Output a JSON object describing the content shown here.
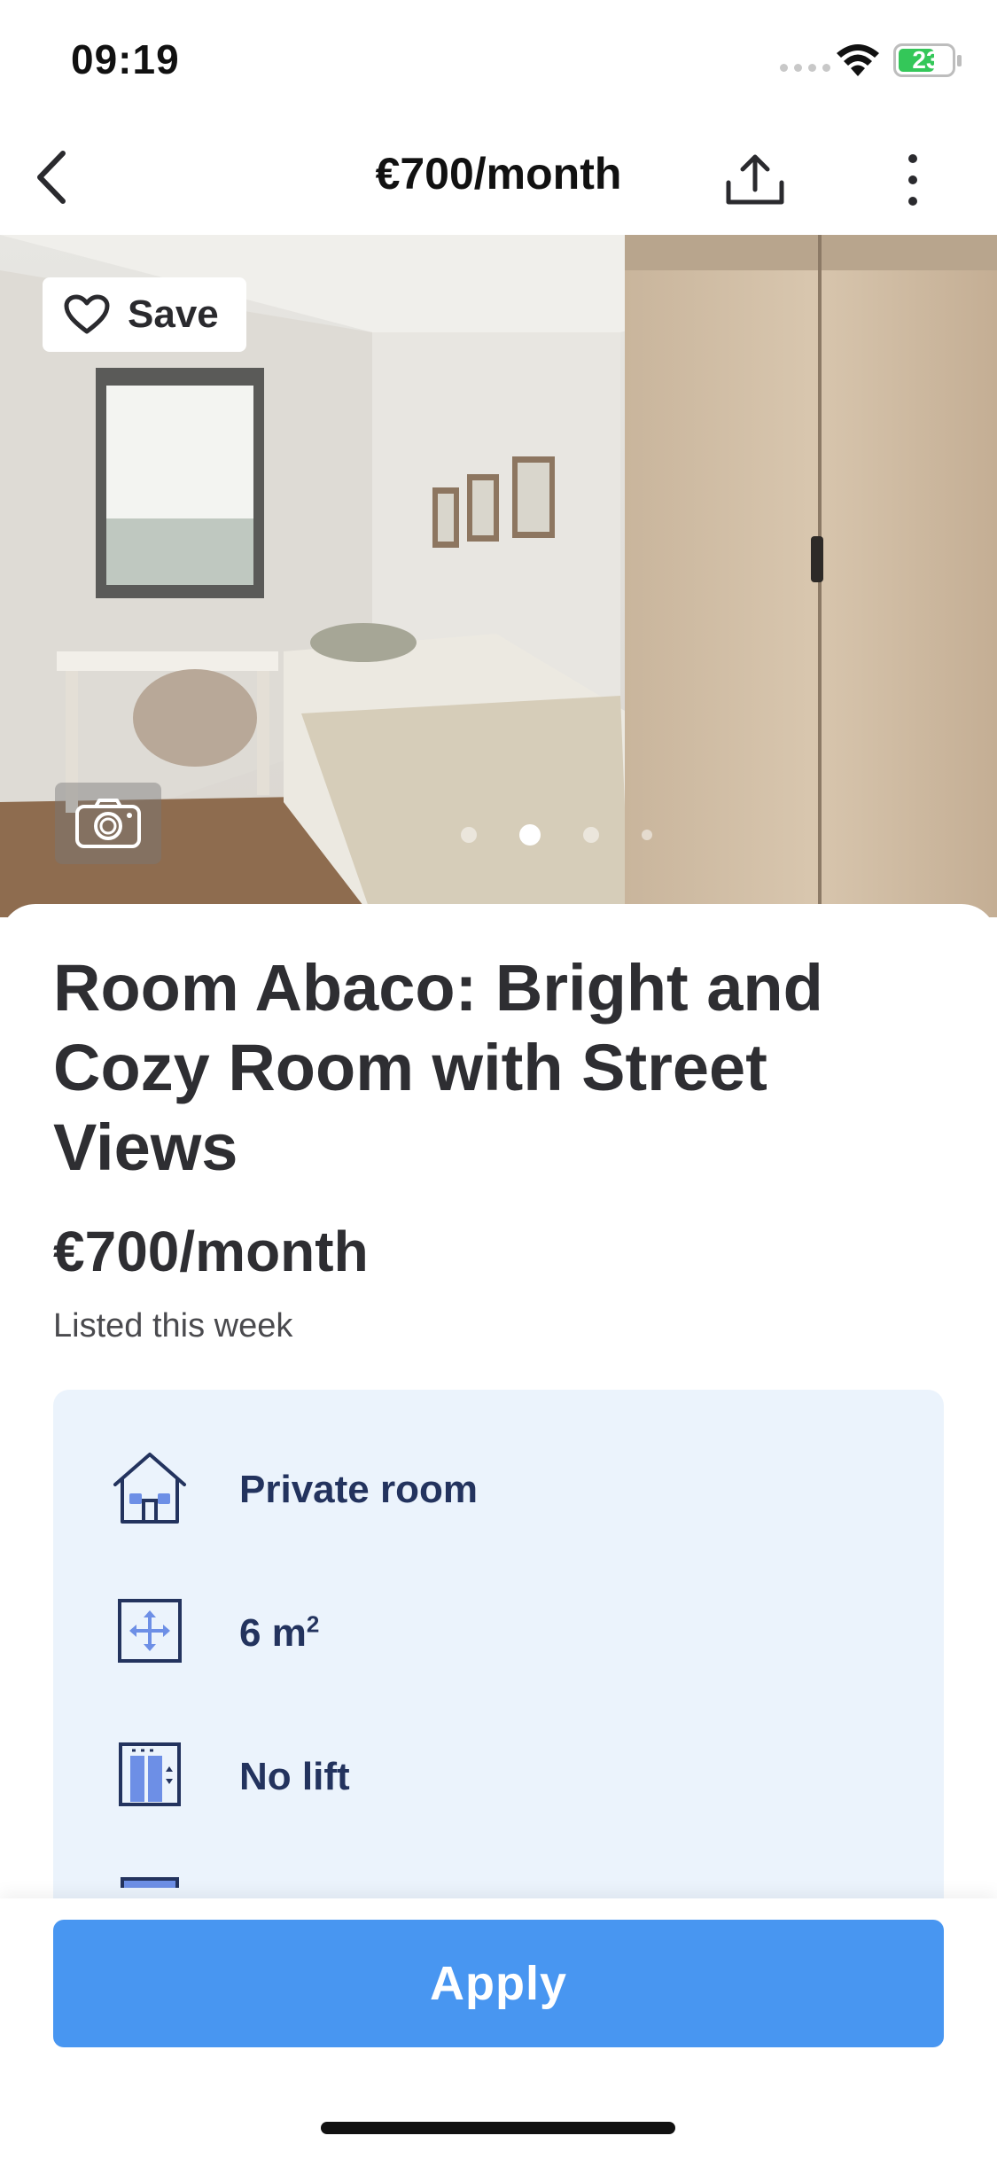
{
  "status_bar": {
    "time": "09:19",
    "battery": "23"
  },
  "nav": {
    "title": "€700/month",
    "back_icon": "chevron-left-icon",
    "share_icon": "share-upload-icon",
    "more_icon": "more-vertical-icon"
  },
  "gallery": {
    "save_label": "Save",
    "photo_count": 4,
    "active_index": 1,
    "camera_icon": "camera-icon",
    "save_icon": "heart-outline-icon"
  },
  "listing": {
    "title": "Room Abaco: Bright and Cozy Room with Street Views",
    "price": "€700/month",
    "listed": "Listed this week"
  },
  "features": [
    {
      "icon": "house-icon",
      "label": "Private room"
    },
    {
      "icon": "area-arrows-icon",
      "label": "6 m",
      "sup": "2"
    },
    {
      "icon": "elevator-icon",
      "label": "No lift"
    },
    {
      "icon": "furniture-icon",
      "label": ""
    }
  ],
  "footer": {
    "apply_label": "Apply"
  },
  "colors": {
    "primary": "#4896f1",
    "feature_bg": "#ebf3fc",
    "feature_text": "#23335e",
    "accent_icon": "#6d8fe6"
  }
}
